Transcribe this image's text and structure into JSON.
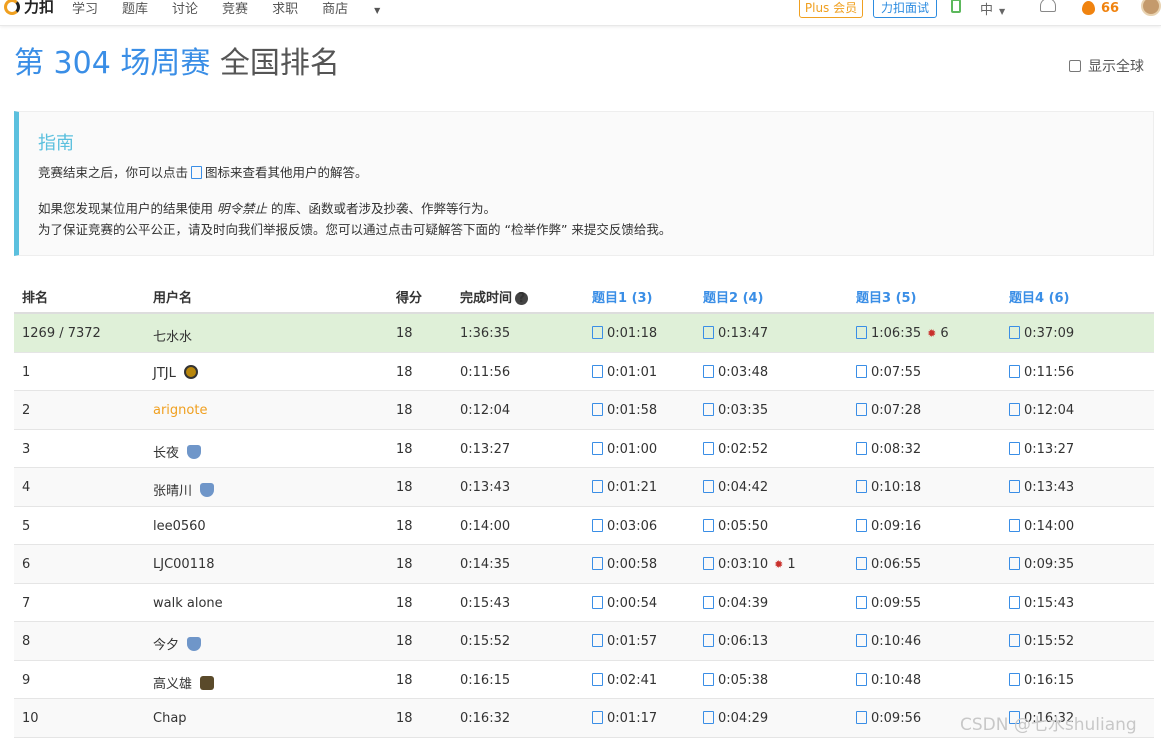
{
  "nav": {
    "logo": "力扣",
    "links": [
      "学习",
      "题库",
      "讨论",
      "竞赛",
      "求职"
    ],
    "store": "商店",
    "plus_label": "Plus 会员",
    "interview_label": "力扣面试",
    "lang": "中",
    "coins": "66"
  },
  "title": {
    "contest": "第 304 场周赛",
    "suffix": "全国排名"
  },
  "global_toggle": "显示全球",
  "guide": {
    "title": "指南",
    "p1_a": "竞赛结束之后，你可以点击",
    "p1_b": "图标来查看其他用户的解答。",
    "p2_a": "如果您发现某位用户的结果使用",
    "p2_em": "明令禁止",
    "p2_b": "的库、函数或者涉及抄袭、作弊等行为。",
    "p3": "为了保证竞赛的公平公正，请及时向我们举报反馈。您可以通过点击可疑解答下面的 “检举作弊” 来提交反馈给我。"
  },
  "table": {
    "headers": {
      "rank": "排名",
      "user": "用户名",
      "score": "得分",
      "time": "完成时间",
      "q1": "题目1 (3)",
      "q2": "题目2 (4)",
      "q3": "题目3 (5)",
      "q4": "题目4 (6)"
    },
    "rows": [
      {
        "rank": "1269 / 7372",
        "user": "七水水",
        "score": "18",
        "time": "1:36:35",
        "q1": "0:01:18",
        "q2": "0:13:47",
        "q3": "1:06:35",
        "q3_bug": "6",
        "q4": "0:37:09"
      },
      {
        "rank": "1",
        "user": "JTJL",
        "score": "18",
        "time": "0:11:56",
        "q1": "0:01:01",
        "q2": "0:03:48",
        "q3": "0:07:55",
        "q4": "0:11:56"
      },
      {
        "rank": "2",
        "user": "arignote",
        "score": "18",
        "time": "0:12:04",
        "q1": "0:01:58",
        "q2": "0:03:35",
        "q3": "0:07:28",
        "q4": "0:12:04"
      },
      {
        "rank": "3",
        "user": "长夜",
        "score": "18",
        "time": "0:13:27",
        "q1": "0:01:00",
        "q2": "0:02:52",
        "q3": "0:08:32",
        "q4": "0:13:27"
      },
      {
        "rank": "4",
        "user": "张晴川",
        "score": "18",
        "time": "0:13:43",
        "q1": "0:01:21",
        "q2": "0:04:42",
        "q3": "0:10:18",
        "q4": "0:13:43"
      },
      {
        "rank": "5",
        "user": "lee0560",
        "score": "18",
        "time": "0:14:00",
        "q1": "0:03:06",
        "q2": "0:05:50",
        "q3": "0:09:16",
        "q4": "0:14:00"
      },
      {
        "rank": "6",
        "user": "LJC00118",
        "score": "18",
        "time": "0:14:35",
        "q1": "0:00:58",
        "q2": "0:03:10",
        "q2_bug": "1",
        "q3": "0:06:55",
        "q4": "0:09:35"
      },
      {
        "rank": "7",
        "user": "walk alone",
        "score": "18",
        "time": "0:15:43",
        "q1": "0:00:54",
        "q2": "0:04:39",
        "q3": "0:09:55",
        "q4": "0:15:43"
      },
      {
        "rank": "8",
        "user": "今夕",
        "score": "18",
        "time": "0:15:52",
        "q1": "0:01:57",
        "q2": "0:06:13",
        "q3": "0:10:46",
        "q4": "0:15:52"
      },
      {
        "rank": "9",
        "user": "高义雄",
        "score": "18",
        "time": "0:16:15",
        "q1": "0:02:41",
        "q2": "0:05:38",
        "q3": "0:10:48",
        "q4": "0:16:15"
      },
      {
        "rank": "10",
        "user": "Chap",
        "score": "18",
        "time": "0:16:32",
        "q1": "0:01:17",
        "q2": "0:04:29",
        "q3": "0:09:56",
        "q4": "0:16:32"
      }
    ]
  },
  "watermark": "CSDN @七水shuliang",
  "colors": {
    "primary": "#3a8ee6",
    "accent": "#f0a020",
    "guide": "#5bc0de",
    "highlight_row": "#dff0d8",
    "bug": "#c9302c"
  }
}
